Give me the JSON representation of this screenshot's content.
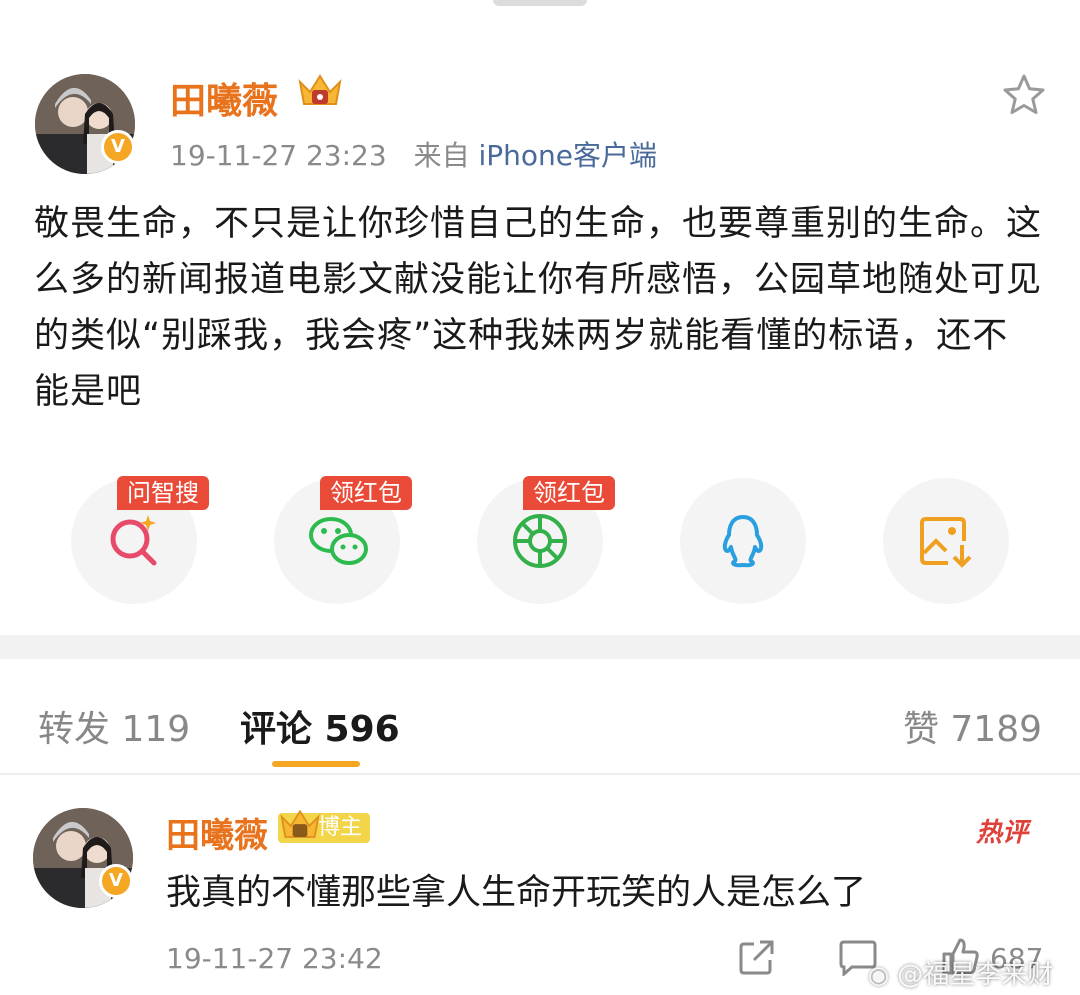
{
  "post": {
    "username": "田曦薇",
    "timestamp": "19-11-27 23:23",
    "source_prefix": "来自",
    "source": "iPhone客户端",
    "text": "敬畏生命，不只是让你珍惜自己的生命，也要尊重别的生命。这么多的新闻报道电影文献没能让你有所感悟，公园草地随处可见的类似“别踩我，我会疼”这种我妹两岁就能看懂的标语，还不能是吧",
    "verified_icon": "verified-v-badge",
    "level_icon": "crown-badge-icon",
    "favorite_icon": "star-icon"
  },
  "share": {
    "items": [
      {
        "name": "smart-search",
        "tag": "问智搜",
        "icon": "search-sparkle-icon"
      },
      {
        "name": "wechat",
        "tag": "领红包",
        "icon": "wechat-icon"
      },
      {
        "name": "moments",
        "tag": "领红包",
        "icon": "moments-shutter-icon"
      },
      {
        "name": "qq",
        "tag": "",
        "icon": "qq-penguin-icon"
      },
      {
        "name": "save-image",
        "tag": "",
        "icon": "save-image-icon"
      }
    ]
  },
  "tabs": {
    "repost": "转发 119",
    "comments": "评论 596",
    "likes": "赞 7189"
  },
  "comment": {
    "username": "田曦薇",
    "badge": "博主",
    "hot_tag": "热评",
    "text": "我真的不懂那些拿人生命开玩笑的人是怎么了",
    "timestamp": "19-11-27 23:42",
    "like_count": "687"
  },
  "watermark": "@福星李来财",
  "colors": {
    "username": "#e8731c",
    "accent": "#f5a623",
    "red_tag": "#ea4b38",
    "link": "#4a6a9a"
  }
}
